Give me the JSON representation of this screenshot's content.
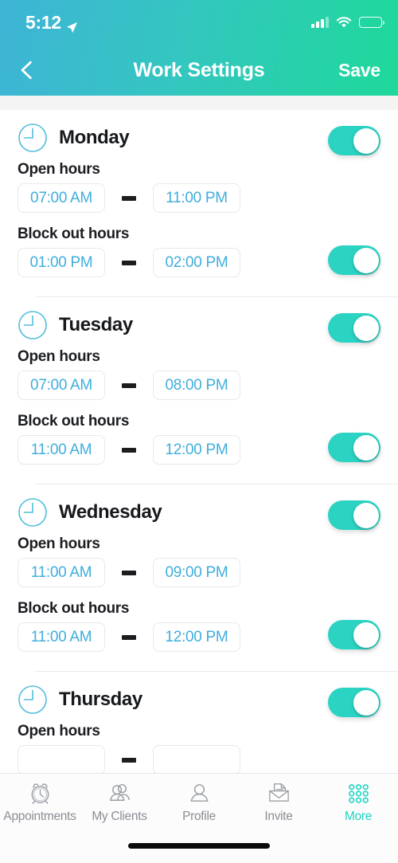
{
  "status_bar": {
    "time": "5:12",
    "location_icon": "location-arrow-icon",
    "signal_icon": "cellular-signal-icon",
    "wifi_icon": "wifi-icon",
    "battery_icon": "battery-icon",
    "battery_color": "#FFC40C"
  },
  "header": {
    "back_icon": "chevron-left-icon",
    "title": "Work Settings",
    "save_label": "Save",
    "gradient_start": "#3EB4D6",
    "gradient_end": "#1ED99A"
  },
  "theme": {
    "toggle_on_color": "#2BD3C3",
    "time_text_color": "#3FAEDD",
    "accent_color": "#1FD4C4"
  },
  "labels": {
    "open_hours": "Open hours",
    "block_out_hours": "Block out hours",
    "clock_icon": "clock-icon",
    "separator": "dash-separator"
  },
  "days": [
    {
      "name": "Monday",
      "enabled": true,
      "open": {
        "start": "07:00 AM",
        "end": "11:00 PM"
      },
      "block": {
        "start": "01:00 PM",
        "end": "02:00 PM",
        "enabled": true
      }
    },
    {
      "name": "Tuesday",
      "enabled": true,
      "open": {
        "start": "07:00 AM",
        "end": "08:00 PM"
      },
      "block": {
        "start": "11:00 AM",
        "end": "12:00 PM",
        "enabled": true
      }
    },
    {
      "name": "Wednesday",
      "enabled": true,
      "open": {
        "start": "11:00 AM",
        "end": "09:00 PM"
      },
      "block": {
        "start": "11:00 AM",
        "end": "12:00 PM",
        "enabled": true
      }
    },
    {
      "name": "Thursday",
      "enabled": true,
      "open": {
        "start": "",
        "end": ""
      },
      "block": {
        "start": "",
        "end": "",
        "enabled": true
      }
    }
  ],
  "tabbar": {
    "items": [
      {
        "label": "Appointments",
        "icon": "alarm-clock-icon",
        "active": false
      },
      {
        "label": "My Clients",
        "icon": "people-group-icon",
        "active": false
      },
      {
        "label": "Profile",
        "icon": "person-icon",
        "active": false
      },
      {
        "label": "Invite",
        "icon": "envelope-icon",
        "active": false
      },
      {
        "label": "More",
        "icon": "grid-dots-icon",
        "active": true
      }
    ]
  }
}
